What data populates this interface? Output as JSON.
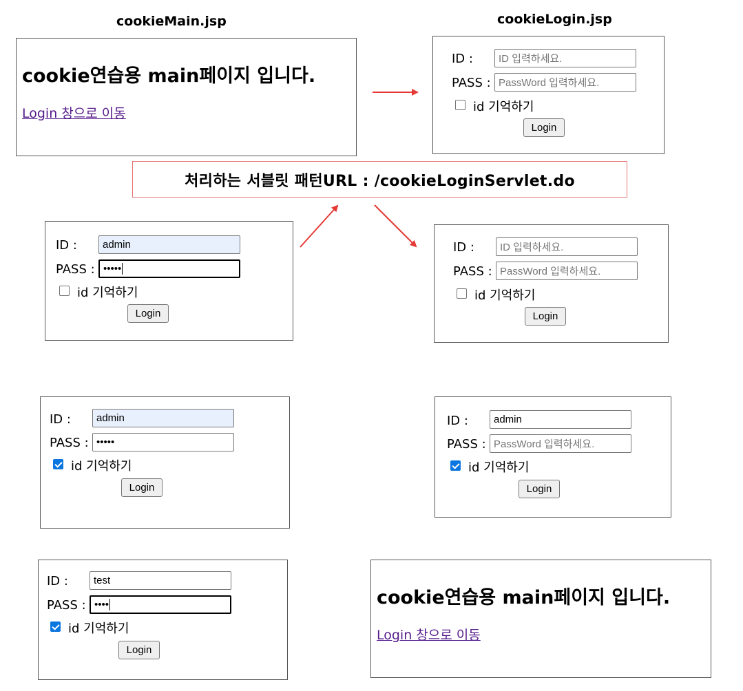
{
  "labels": {
    "main_file": "cookieMain.jsp",
    "login_file": "cookieLogin.jsp"
  },
  "servlet_box": {
    "text": "처리하는 서블릿 패턴URL : /cookieLoginServlet.do"
  },
  "main_page": {
    "title": "cookie연습용 main페이지 입니다.",
    "link": "Login 창으로 이동"
  },
  "form_labels": {
    "id": "ID :",
    "pass": "PASS :",
    "remember": "id 기억하기",
    "login": "Login"
  },
  "placeholders": {
    "id": "ID 입력하세요.",
    "pass": "PassWord 입력하세요."
  },
  "forms": {
    "f2": {
      "id_value": "admin",
      "pass_mask": "•••••",
      "remember": false
    },
    "f4": {
      "id_value": "admin",
      "pass_mask": "•••••",
      "remember": true
    },
    "f5": {
      "id_value": "admin",
      "remember": true
    },
    "f6": {
      "id_value": "test",
      "pass_mask": "••••",
      "remember": true
    }
  },
  "colors": {
    "arrow": "#e53935",
    "servlet_border": "#e57373",
    "link": "#551a8b",
    "checkbox": "#0b76e0",
    "autofill": "#e8f0fe"
  }
}
